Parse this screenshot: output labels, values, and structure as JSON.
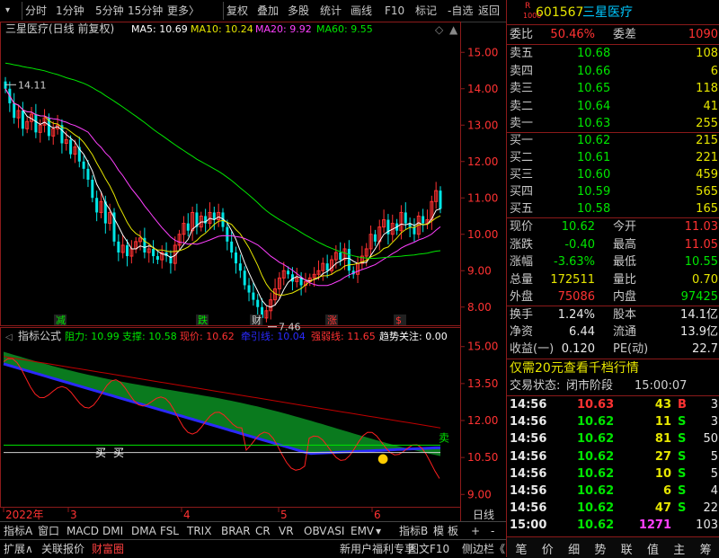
{
  "toolbar": {
    "items": [
      "分时",
      "1分钟",
      "5分钟",
      "15分钟",
      "更多〉",
      "复权",
      "叠加",
      "多股",
      "统计",
      "画线",
      "F10",
      "标记",
      "-自选",
      "返回"
    ]
  },
  "main_header": {
    "title": "三星医疗(日线 前复权)",
    "ma5": "MA5: 10.69",
    "ma10": "MA10: 10.24",
    "ma20": "MA20: 9.92",
    "ma60": "MA60: 9.55"
  },
  "sub_header": {
    "name": "指标公式",
    "resist": "阻力: 10.99",
    "support": "支撑: 10.58",
    "price": "现价: 10.62",
    "lead": "牵引线: 10.04",
    "strong": "强弱线: 11.65",
    "trend": "趋势关注: 0.00"
  },
  "annotations": {
    "high": "14.11",
    "low": "7.46",
    "buy1": "买",
    "buy2": "买",
    "sell": "卖",
    "sig_jian": "减",
    "sig_die": "跌",
    "sig_cai": "财",
    "sig_zhang": "涨",
    "sig_dollar": "$",
    "cycle": "日线"
  },
  "colors": {
    "up": "#ff3232",
    "down": "#00e6e6",
    "ma5": "#ffffff",
    "ma10": "#e6e600",
    "ma20": "#ff40ff",
    "ma60": "#00e600",
    "band": "#0a7a1e",
    "support_line": "#2a2aff"
  },
  "chart_data": [
    {
      "type": "candlestick",
      "title": "三星医疗(日线 前复权)",
      "ylim": [
        7.5,
        15.5
      ],
      "y_ticks": [
        "15.00",
        "14.00",
        "13.00",
        "12.00",
        "11.00",
        "10.00",
        "9.00",
        "8.00"
      ],
      "x_ticks": [
        "2022年",
        "3",
        "4",
        "5",
        "6"
      ],
      "close": [
        14.0,
        13.6,
        13.2,
        13.4,
        12.9,
        13.1,
        13.3,
        12.8,
        13.0,
        13.2,
        12.7,
        12.9,
        13.0,
        12.5,
        12.6,
        12.2,
        12.4,
        12.0,
        11.8,
        11.5,
        11.0,
        10.6,
        10.9,
        10.3,
        10.6,
        9.8,
        9.5,
        9.7,
        9.4,
        9.6,
        9.8,
        9.9,
        9.5,
        9.6,
        9.4,
        9.3,
        9.5,
        9.4,
        9.2,
        9.7,
        10.0,
        10.3,
        10.1,
        10.6,
        10.2,
        10.5,
        10.3,
        10.6,
        10.4,
        10.6,
        10.2,
        9.8,
        9.5,
        9.2,
        9.0,
        8.6,
        8.4,
        8.2,
        8.0,
        7.7,
        7.9,
        8.2,
        8.5,
        8.8,
        9.0,
        8.9,
        8.7,
        8.8,
        8.6,
        8.7,
        8.8,
        8.9,
        9.0,
        9.2,
        9.0,
        9.3,
        9.5,
        9.3,
        9.6,
        9.0,
        8.9,
        9.2,
        9.4,
        9.6,
        10.0,
        9.8,
        10.2,
        10.4,
        10.0,
        10.3,
        10.1,
        10.6,
        10.3,
        10.2,
        10.0,
        10.5,
        10.3,
        10.4,
        10.9,
        11.2,
        10.7
      ],
      "ma": {
        "MA5": 10.69,
        "MA10": 10.24,
        "MA20": 9.92,
        "MA60": 9.55
      }
    },
    {
      "type": "area",
      "title": "指标公式",
      "ylim": [
        8.5,
        15.5
      ],
      "y_ticks": [
        "15.00",
        "13.50",
        "12.00",
        "10.50",
        "9.00"
      ],
      "series": [
        {
          "name": "阻力",
          "values": [
            10.99
          ]
        },
        {
          "name": "支撑",
          "values": [
            10.58
          ]
        },
        {
          "name": "现价",
          "values": [
            10.62
          ]
        },
        {
          "name": "牵引线",
          "values": [
            10.04
          ]
        },
        {
          "name": "强弱线",
          "values": [
            11.65
          ]
        },
        {
          "name": "趋势关注",
          "values": [
            0.0
          ]
        }
      ]
    }
  ],
  "quote": {
    "logo": "R",
    "logo_sub": "1000",
    "code": "601567",
    "name": "三星医疗",
    "weibi_label": "委比",
    "weibi": "50.46%",
    "weicha_label": "委差",
    "weicha": "1090",
    "asks": [
      {
        "label": "卖五",
        "price": "10.68",
        "vol": "108"
      },
      {
        "label": "卖四",
        "price": "10.66",
        "vol": "6"
      },
      {
        "label": "卖三",
        "price": "10.65",
        "vol": "118"
      },
      {
        "label": "卖二",
        "price": "10.64",
        "vol": "41"
      },
      {
        "label": "卖一",
        "price": "10.63",
        "vol": "255"
      }
    ],
    "bids": [
      {
        "label": "买一",
        "price": "10.62",
        "vol": "215"
      },
      {
        "label": "买二",
        "price": "10.61",
        "vol": "221"
      },
      {
        "label": "买三",
        "price": "10.60",
        "vol": "459"
      },
      {
        "label": "买四",
        "price": "10.59",
        "vol": "565"
      },
      {
        "label": "买五",
        "price": "10.58",
        "vol": "165"
      }
    ],
    "stats": [
      {
        "l1": "现价",
        "v1": "10.62",
        "c1": "green",
        "l2": "今开",
        "v2": "11.03",
        "c2": "red"
      },
      {
        "l1": "涨跌",
        "v1": "-0.40",
        "c1": "green",
        "l2": "最高",
        "v2": "11.05",
        "c2": "red"
      },
      {
        "l1": "涨幅",
        "v1": "-3.63%",
        "c1": "green",
        "l2": "最低",
        "v2": "10.55",
        "c2": "green"
      },
      {
        "l1": "总量",
        "v1": "172511",
        "c1": "yellow",
        "l2": "量比",
        "v2": "0.70",
        "c2": "yellow"
      },
      {
        "l1": "外盘",
        "v1": "75086",
        "c1": "red",
        "l2": "内盘",
        "v2": "97425",
        "c2": "green"
      }
    ],
    "stats2": [
      {
        "l1": "换手",
        "v1": "1.24%",
        "l2": "股本",
        "v2": "14.1亿"
      },
      {
        "l1": "净资",
        "v1": "6.44",
        "l2": "流通",
        "v2": "13.9亿"
      },
      {
        "l1": "收益(一)",
        "v1": "0.120",
        "l2": "PE(动)",
        "v2": "22.7"
      }
    ],
    "promo": "仅需20元查看千档行情",
    "trade_status_label": "交易状态:",
    "trade_status": "闭市阶段",
    "trade_time": "15:00:07",
    "ticks": [
      {
        "t": "14:56",
        "p": "10.63",
        "pc": "red",
        "v": "43",
        "s": "B",
        "sc": "red",
        "n": "3"
      },
      {
        "t": "14:56",
        "p": "10.62",
        "pc": "green",
        "v": "11",
        "s": "S",
        "sc": "green",
        "n": "3"
      },
      {
        "t": "14:56",
        "p": "10.62",
        "pc": "green",
        "v": "81",
        "s": "S",
        "sc": "green",
        "n": "50"
      },
      {
        "t": "14:56",
        "p": "10.62",
        "pc": "green",
        "v": "27",
        "s": "S",
        "sc": "green",
        "n": "5"
      },
      {
        "t": "14:56",
        "p": "10.62",
        "pc": "green",
        "v": "10",
        "s": "S",
        "sc": "green",
        "n": "5"
      },
      {
        "t": "14:56",
        "p": "10.62",
        "pc": "green",
        "v": "6",
        "s": "S",
        "sc": "green",
        "n": "4"
      },
      {
        "t": "14:56",
        "p": "10.62",
        "pc": "green",
        "v": "47",
        "s": "S",
        "sc": "green",
        "n": "22"
      },
      {
        "t": "15:00",
        "p": "10.62",
        "pc": "green",
        "v": "1271",
        "s": "",
        "sc": "green",
        "n": "103"
      }
    ],
    "bottom_tabs": [
      "笔",
      "价",
      "细",
      "势",
      "联",
      "值",
      "主",
      "筹"
    ]
  },
  "bottombar": {
    "items": [
      "指标A",
      "窗口",
      "MACD",
      "DMI",
      "DMA",
      "FSL",
      "TRIX",
      "BRAR",
      "CR",
      "VR",
      "OBV",
      "ASI",
      "EMV",
      "▾",
      "指标B",
      "模",
      "板",
      "+",
      "-"
    ]
  },
  "statusbar": {
    "left": [
      "扩展∧",
      "关联报价",
      "财富圈"
    ],
    "right": [
      "新用户福利专享",
      "图文F10",
      "侧边栏《"
    ]
  }
}
